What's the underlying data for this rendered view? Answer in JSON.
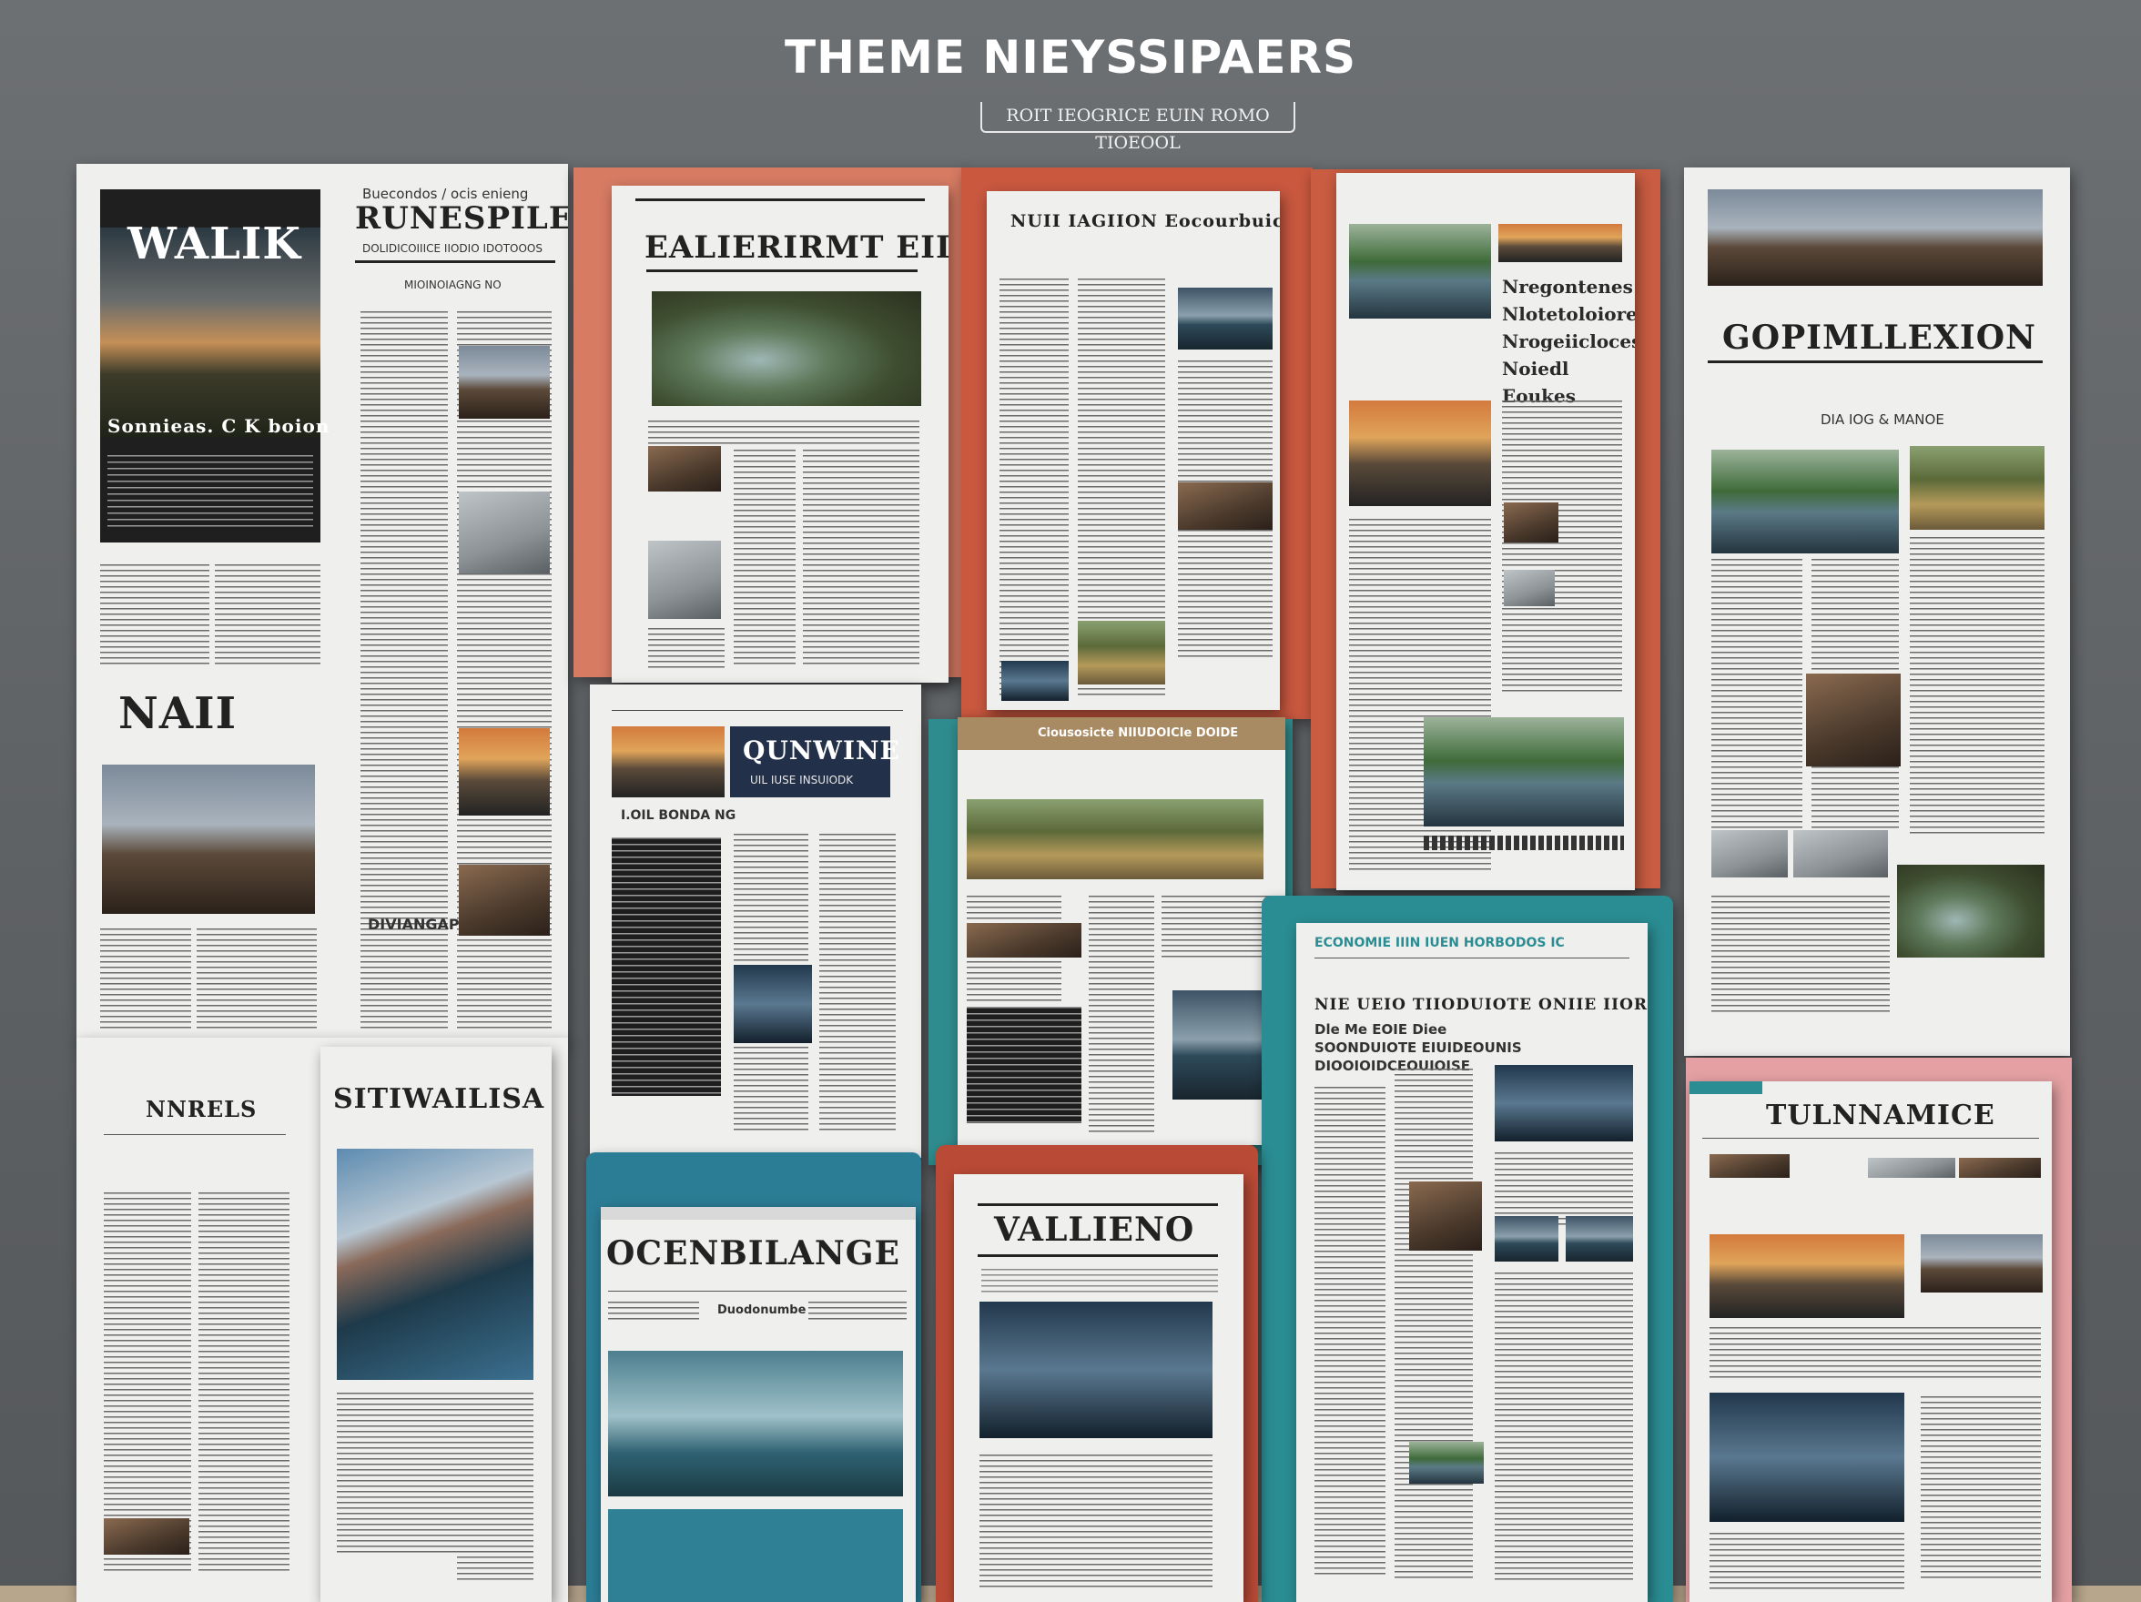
{
  "header": {
    "title": "THEME NIEYSSIPAERS",
    "subtitle": "ROIT IEOGRICE EUIN ROMO TIOEOOL"
  },
  "papers": {
    "p1": {
      "cover_title": "WALIK",
      "cover_sub": "Sonnieas. C K boion",
      "side_kicker": "Buecondos / ocis enieng",
      "side_title": "RUNESPILES",
      "side_dek": "DOLIDICOIIICE IIODIO IDOTOOOS",
      "side_byline": "MIOINOIAGNG NO",
      "section_title": "NAII",
      "section_sub": "DIVIANGAP"
    },
    "p2": {
      "title": "EALIERIRMT EIIIP"
    },
    "p3": {
      "title": "NUII IAGIION Eocourbuickeet MS"
    },
    "p4": {
      "title_lines": [
        "Nregontenes",
        "Nlotetoloiore",
        "Nrogeiicloces",
        "Noiedl Eoukes"
      ]
    },
    "p5": {
      "title": "GOPIMLLEXION",
      "kicker": "DIA IOG & MANOE"
    },
    "p6": {
      "masthead": "QUNWINE",
      "masthead_sub": "UIL IUSE INSUIODK",
      "section": "I.OIL BONDA NG"
    },
    "p7": {
      "masthead": "Ciousosicte NIIUDOICIe DOIDE"
    },
    "p8": {
      "masthead": "ECONOMIE IIIN IUEN HORBODOS IC",
      "dek": "NIE UEIO TIIODUIOTE ONIIE IIOR",
      "lines": [
        "Dle Me EOIE Diee",
        "SOONDUIOTE EIUIDEOUNIS",
        "DIOOIOIDCEOUIOISE"
      ]
    },
    "p9": {
      "title": "NNRELS"
    },
    "p10": {
      "title": "SITIWAILISA"
    },
    "p11": {
      "title": "OCENBILANGE",
      "kicker": "Duodonumbe"
    },
    "p12": {
      "title": "VALLIENO"
    },
    "p13": {
      "title": "TULNNAMICE"
    }
  }
}
